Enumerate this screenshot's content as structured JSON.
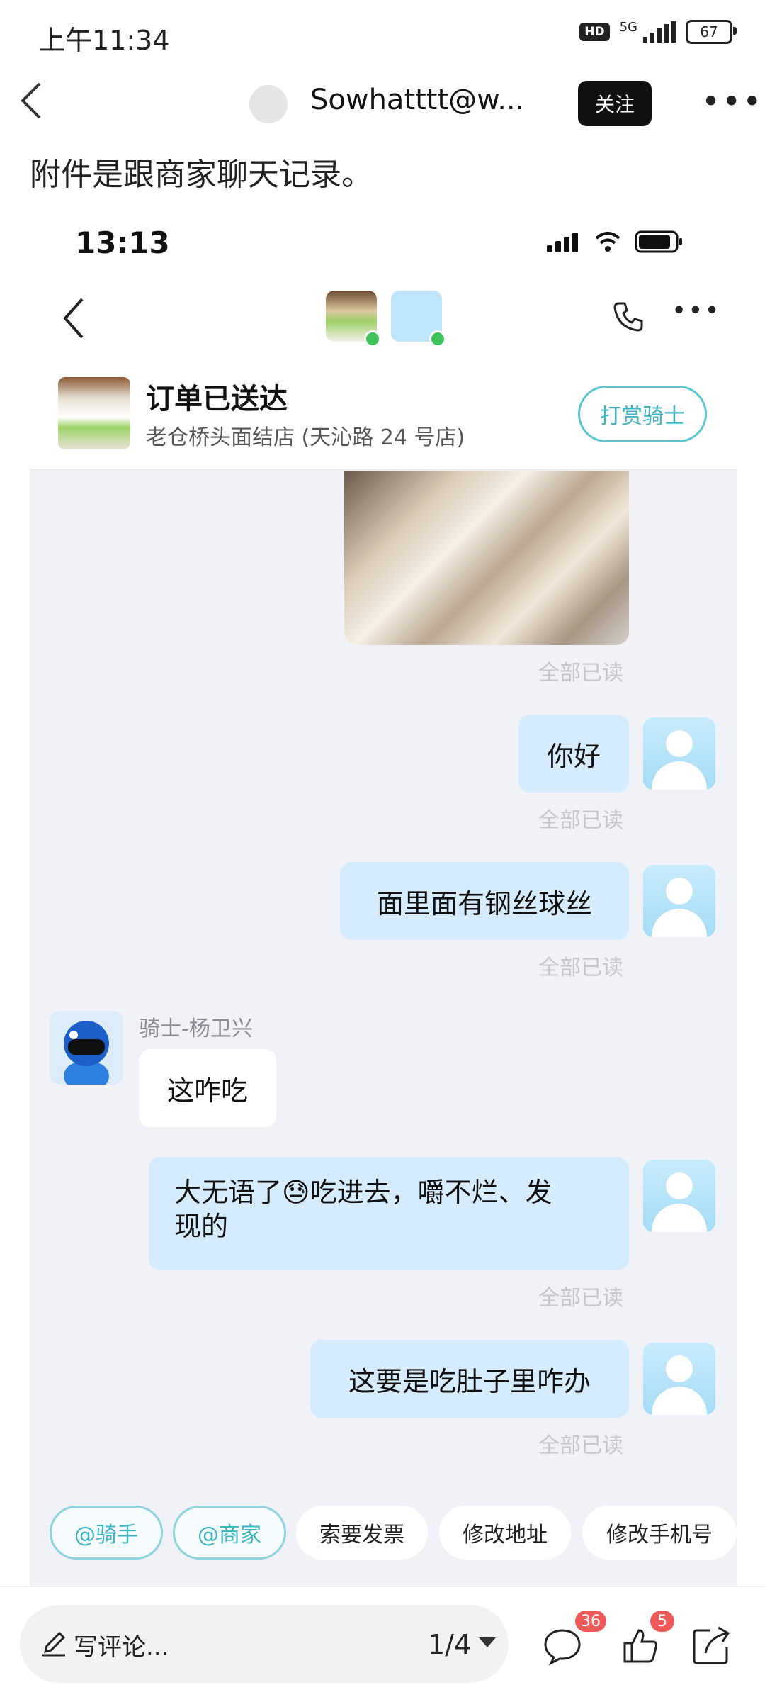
{
  "status_bar": {
    "time": "上午11:34",
    "network": "5G",
    "hd": "HD",
    "battery": "67"
  },
  "header": {
    "username": "Sowhatttt@w...",
    "follow_label": "关注"
  },
  "post": {
    "text": "附件是跟商家聊天记录。"
  },
  "screenshot": {
    "time": "13:13",
    "order_status": "订单已送达",
    "store_name": "老仓桥头面结店 (天沁路 24 号店)",
    "tip_label": "打赏骑士",
    "read_label": "全部已读",
    "messages": [
      {
        "from": "me",
        "text": "你好"
      },
      {
        "from": "me",
        "text": "面里面有钢丝球丝"
      },
      {
        "from": "rider",
        "sender": "骑士-杨卫兴",
        "text": "这咋吃"
      },
      {
        "from": "me",
        "text_line1": "大无语了",
        "emoji": "😓",
        "text_line1b": "吃进去，嚼不烂、发",
        "text_line2": "现的"
      },
      {
        "from": "me",
        "text": "这要是吃肚子里咋办"
      }
    ],
    "quick_actions": [
      "@骑手",
      "@商家",
      "索要发票",
      "修改地址",
      "修改手机号"
    ]
  },
  "bottom_bar": {
    "comment_placeholder": "写评论...",
    "pager": "1/4",
    "comment_count": "36",
    "like_count": "5"
  }
}
